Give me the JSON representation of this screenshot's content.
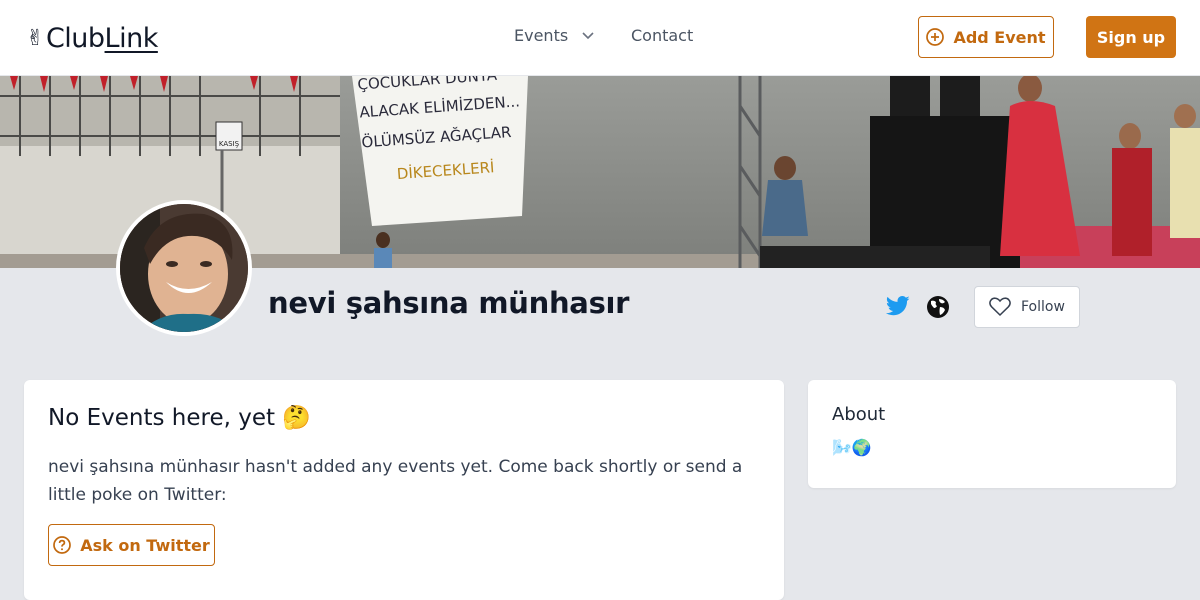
{
  "nav": {
    "logo_text_plain": "Club",
    "logo_text_link": "Link",
    "logo_icon": "✌",
    "events_label": "Events",
    "contact_label": "Contact",
    "add_event_label": "Add Event",
    "signup_label": "Sign up"
  },
  "banner": {
    "sign_text": "KASIŞ",
    "banner_lines": [
      "ÇOCUKLAR DÜNYA",
      "ALACAK ELİMİZDEN...",
      "ÖLÜMSÜZ AĞAÇLAR",
      "DİKECEKLERİ"
    ]
  },
  "profile": {
    "name": "nevi şahsına münhasır",
    "follow_label": "Follow"
  },
  "events": {
    "title": "No Events here, yet 🤔",
    "message": "nevi şahsına münhasır hasn't added any events yet. Come back shortly or send a little poke on Twitter:",
    "ask_label": "Ask on Twitter"
  },
  "about": {
    "title": "About",
    "text": "🌬️🌍"
  },
  "colors": {
    "accent": "#d07414",
    "twitter": "#1d9bf0",
    "page_bg": "#e5e7eb"
  }
}
